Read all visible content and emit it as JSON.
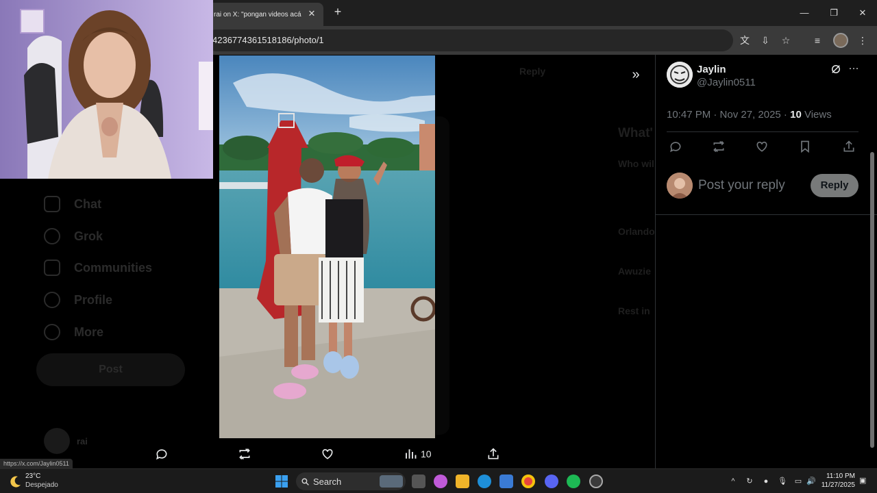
{
  "browser": {
    "tab_title": "rai on X: \"pongan videos acá para un",
    "url": "4236774361518186/photo/1",
    "tab_close": "✕",
    "new_tab": "+"
  },
  "sidebar": {
    "items": [
      {
        "label": "Chat",
        "icon": "chat-icon"
      },
      {
        "label": "Grok",
        "icon": "grok-icon"
      },
      {
        "label": "Communities",
        "icon": "communities-icon"
      },
      {
        "label": "Profile",
        "icon": "profile-icon"
      },
      {
        "label": "More",
        "icon": "more-icon"
      }
    ],
    "post_label": "Post",
    "account_name": "rai"
  },
  "background_page": {
    "reply_label": "Reply",
    "whats_label": "What'",
    "who_label": "Who wil",
    "orlando": "Orlando",
    "awuzie": "Awuzie",
    "rest": "Rest in"
  },
  "photo_actions": {
    "views": "10"
  },
  "post": {
    "name": "Jaylin",
    "handle": "@Jaylin0511",
    "time": "10:47 PM · Nov 27, 2025 · ",
    "views_count": "10",
    "views_label": " Views",
    "reply_placeholder": "Post your reply",
    "reply_button": "Reply"
  },
  "status_url": "https://x.com/Jaylin0511",
  "taskbar": {
    "temperature": "23°C",
    "weather": "Despejado",
    "search": "Search",
    "time": "11:10 PM",
    "date": "11/27/2025"
  },
  "colors": {
    "accent": "#1d9bf0",
    "muted": "#71767b",
    "text": "#e7e9ea"
  }
}
